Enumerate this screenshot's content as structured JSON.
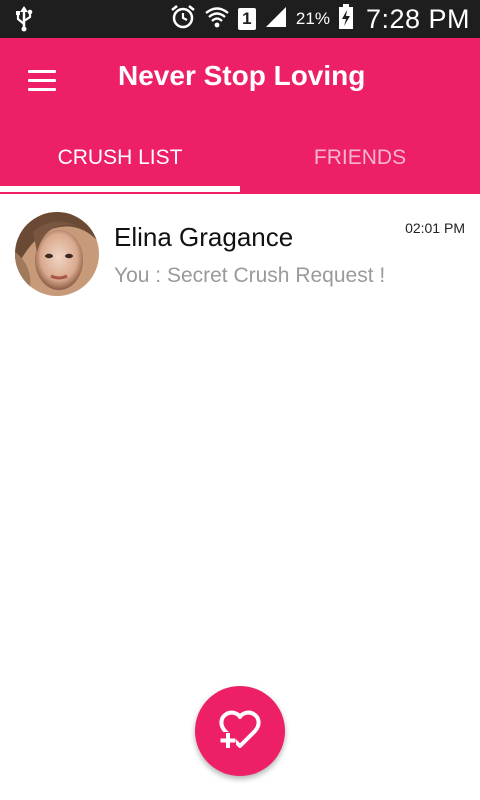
{
  "status_bar": {
    "battery_percent": "21%",
    "time": "7:28 PM",
    "sim_slot": "1"
  },
  "app_bar": {
    "title": "Never Stop Loving",
    "accent_color": "#ec1f67"
  },
  "tabs": [
    {
      "label": "CRUSH LIST",
      "active": true
    },
    {
      "label": "FRIENDS",
      "active": false
    }
  ],
  "crush_list": [
    {
      "name": "Elina Gragance",
      "message": "You : Secret Crush Request !",
      "time": "02:01 PM"
    }
  ],
  "icons": {
    "menu": "hamburger-menu-icon",
    "fab": "heart-plus-icon",
    "status": [
      "usb-icon",
      "alarm-icon",
      "wifi-icon",
      "sim-icon",
      "signal-icon",
      "battery-charging-icon"
    ]
  }
}
